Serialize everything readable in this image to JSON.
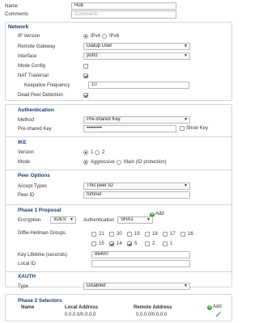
{
  "top": {
    "name_label": "Name",
    "name_value": "Hub",
    "comments_label": "Comments",
    "comments_placeholder": "Comments"
  },
  "network": {
    "title": "Network",
    "ip_version_label": "IP Version",
    "ip_version_options": [
      "IPv4",
      "IPv6"
    ],
    "ip_version_selected": "IPv4",
    "remote_gateway_label": "Remote Gateway",
    "remote_gateway_value": "Dialup User",
    "interface_label": "Interface",
    "interface_value": "port2",
    "mode_config_label": "Mode Config",
    "mode_config_checked": false,
    "nat_traversal_label": "NAT Traversal",
    "nat_traversal_checked": true,
    "keepalive_label": "Keepalive Frequency",
    "keepalive_value": "10",
    "dpd_label": "Dead Peer Detection",
    "dpd_checked": true
  },
  "authentication": {
    "title": "Authentication",
    "method_label": "Method",
    "method_value": "Pre-shared Key",
    "psk_label": "Pre-shared Key",
    "psk_value": "•••••••••",
    "show_key_label": "Show Key",
    "show_key_checked": false
  },
  "ike": {
    "title": "IKE",
    "version_label": "Version",
    "version_options": [
      "1",
      "2"
    ],
    "version_selected": "1",
    "mode_label": "Mode",
    "mode_options": [
      "Aggressive",
      "Main (ID protection)"
    ],
    "mode_selected": "Aggressive"
  },
  "peer_options": {
    "title": "Peer Options",
    "accept_types_label": "Accept Types",
    "accept_types_value": "This peer ID",
    "peer_id_label": "Peer ID",
    "peer_id_value": "fortinet"
  },
  "phase1": {
    "title": "Phase 1 Proposal",
    "add_label": "Add",
    "encryption_label": "Encryption",
    "encryption_value": "3DES",
    "authentication_label": "Authentication",
    "authentication_value": "SHA1",
    "dh_label": "Diffie-Hellman Groups",
    "dh_groups": [
      {
        "label": "21",
        "checked": false
      },
      {
        "label": "20",
        "checked": false
      },
      {
        "label": "19",
        "checked": false
      },
      {
        "label": "18",
        "checked": false
      },
      {
        "label": "17",
        "checked": false
      },
      {
        "label": "16",
        "checked": false
      },
      {
        "label": "15",
        "checked": false
      },
      {
        "label": "14",
        "checked": true
      },
      {
        "label": "5",
        "checked": true
      },
      {
        "label": "2",
        "checked": false
      },
      {
        "label": "1",
        "checked": false
      }
    ],
    "key_lifetime_label": "Key Lifetime (seconds)",
    "key_lifetime_value": "86400",
    "local_id_label": "Local ID",
    "local_id_value": ""
  },
  "xauth": {
    "title": "XAUTH",
    "type_label": "Type",
    "type_value": "Disabled"
  },
  "phase2": {
    "title": "Phase 2 Selectors",
    "add_label": "Add",
    "columns": [
      "Name",
      "Local Address",
      "Remote Address"
    ],
    "rows": [
      {
        "name": "",
        "local": "0.0.0.0/0.0.0.0",
        "remote": "0.0.0.0/0.0.0.0"
      }
    ]
  },
  "colors": {
    "section_title": "#1b3b6b",
    "border": "#d0d7e0",
    "add_icon": "#2eaa3c",
    "edit_icon": "#2b6fd6"
  }
}
